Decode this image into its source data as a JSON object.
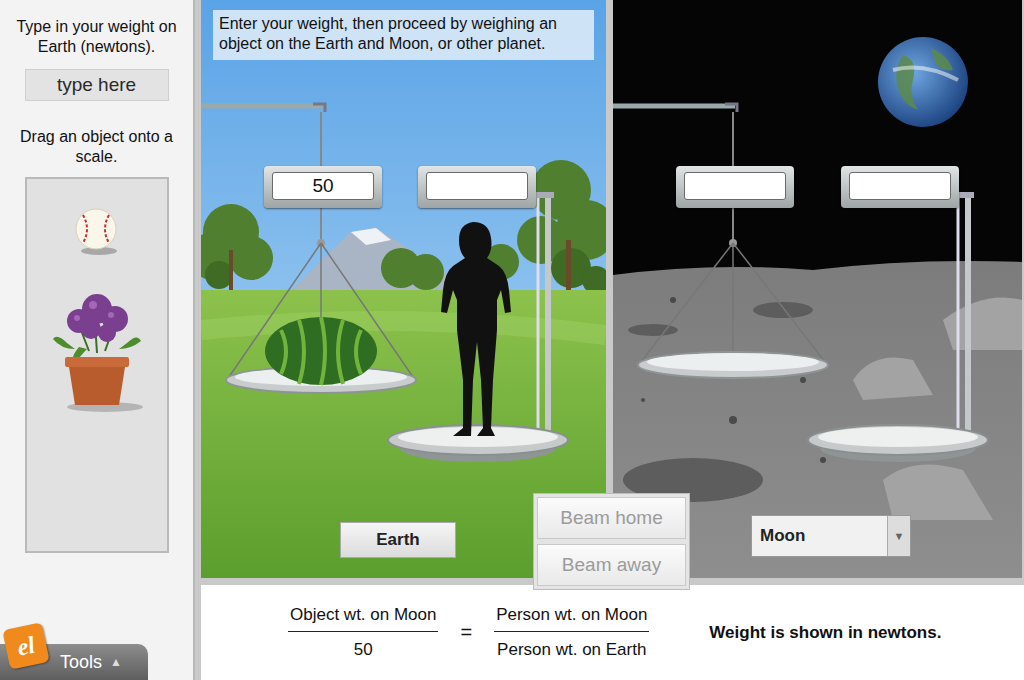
{
  "sidebar": {
    "weight_prompt": "Type in your weight on Earth (newtons).",
    "weight_input": {
      "placeholder": "type here"
    },
    "drag_prompt": "Drag an object onto a scale."
  },
  "tools": {
    "logo": "el",
    "label": "Tools",
    "arrow": "▲"
  },
  "instruction": "Enter your weight, then proceed by weighing an object on the Earth and Moon, or other planet.",
  "earth": {
    "label": "Earth",
    "pan_reading": "50",
    "platform_reading": ""
  },
  "moon": {
    "selector": "Moon",
    "arrow": "▼",
    "pan_reading": "",
    "platform_reading": ""
  },
  "buttons": [
    {
      "label": "Beam home",
      "disabled": true
    },
    {
      "label": "Beam away",
      "disabled": true
    }
  ],
  "formula": {
    "left_num": "Object wt. on Moon",
    "left_den": "50",
    "equals": "=",
    "right_num": "Person wt. on Moon",
    "right_den": "Person wt. on Earth"
  },
  "units_note": "Weight is shown in newtons."
}
